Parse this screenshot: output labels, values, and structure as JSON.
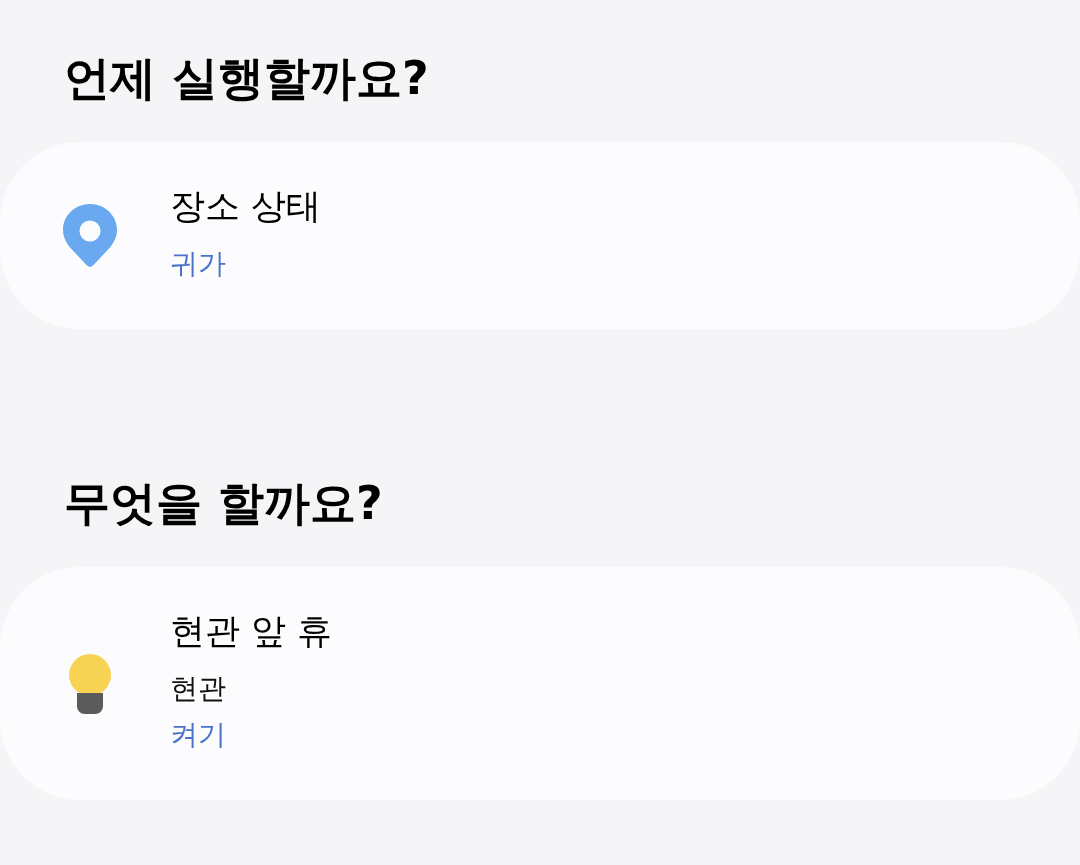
{
  "sections": [
    {
      "heading": "언제 실행할까요?",
      "cards": [
        {
          "kind": "location",
          "title": "장소 상태",
          "lines": [
            {
              "kind": "value",
              "text": "귀가"
            }
          ]
        }
      ]
    },
    {
      "heading": "무엇을 할까요?",
      "cards": [
        {
          "kind": "light",
          "title": "현관 앞 휴",
          "lines": [
            {
              "kind": "detail",
              "text": "현관"
            },
            {
              "kind": "value",
              "text": "켜기"
            }
          ]
        }
      ]
    }
  ]
}
